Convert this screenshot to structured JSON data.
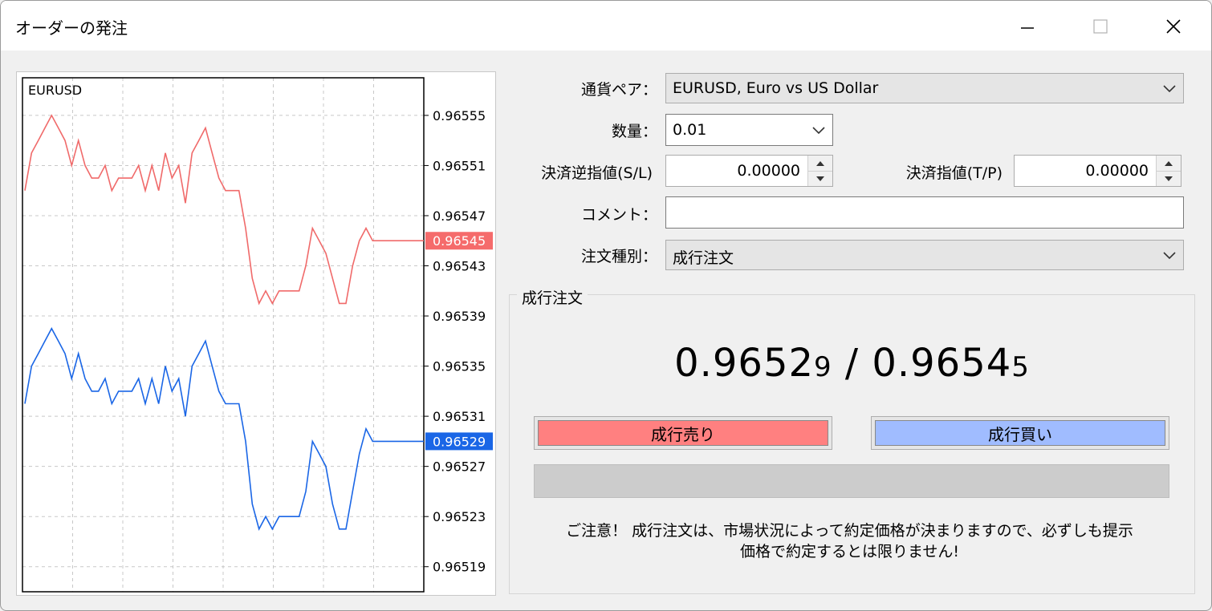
{
  "window": {
    "title": "オーダーの発注",
    "minimize_icon": "minimize-icon",
    "maximize_icon": "maximize-icon",
    "close_icon": "close-icon"
  },
  "chart": {
    "symbol": "EURUSD",
    "price_labels": [
      "0.96555",
      "0.96551",
      "0.96547",
      "0.96543",
      "0.96539",
      "0.96535",
      "0.96531",
      "0.96527",
      "0.96523",
      "0.96519"
    ],
    "ask_badge": "0.96545",
    "bid_badge": "0.96529",
    "colors": {
      "ask": "#f06a6a",
      "bid": "#1a66e6",
      "ask_badge_bg": "#f56b6b",
      "bid_badge_bg": "#1a66e6"
    }
  },
  "chart_data": {
    "type": "line",
    "title": "EURUSD",
    "ylim": [
      0.96517,
      0.96558
    ],
    "grid": true,
    "series": [
      {
        "values": [
          0.96549,
          0.96552,
          0.96553,
          0.96554,
          0.96555,
          0.96554,
          0.96553,
          0.96551,
          0.96553,
          0.96551,
          0.9655,
          0.9655,
          0.96551,
          0.96549,
          0.9655,
          0.9655,
          0.9655,
          0.96551,
          0.96549,
          0.96551,
          0.96549,
          0.96552,
          0.9655,
          0.96551,
          0.96548,
          0.96552,
          0.96553,
          0.96554,
          0.96552,
          0.9655,
          0.96549,
          0.96549,
          0.96549,
          0.96546,
          0.96542,
          0.9654,
          0.96541,
          0.9654,
          0.96541,
          0.96541,
          0.96541,
          0.96541,
          0.96543,
          0.96546,
          0.96545,
          0.96544,
          0.96542,
          0.9654,
          0.9654,
          0.96543,
          0.96545,
          0.96546,
          0.96545,
          0.96545,
          0.96545
        ]
      },
      {
        "values": [
          0.96532,
          0.96535,
          0.96536,
          0.96537,
          0.96538,
          0.96537,
          0.96536,
          0.96534,
          0.96536,
          0.96534,
          0.96533,
          0.96533,
          0.96534,
          0.96532,
          0.96533,
          0.96533,
          0.96533,
          0.96534,
          0.96532,
          0.96534,
          0.96532,
          0.96535,
          0.96533,
          0.96534,
          0.96531,
          0.96535,
          0.96536,
          0.96537,
          0.96535,
          0.96533,
          0.96532,
          0.96532,
          0.96532,
          0.96529,
          0.96524,
          0.96522,
          0.96523,
          0.96522,
          0.96523,
          0.96523,
          0.96523,
          0.96523,
          0.96525,
          0.96529,
          0.96528,
          0.96527,
          0.96524,
          0.96522,
          0.96522,
          0.96525,
          0.96528,
          0.9653,
          0.96529,
          0.96529,
          0.96529
        ]
      }
    ]
  },
  "form": {
    "pair_label": "通貨ペア：",
    "pair_value": "EURUSD, Euro vs US Dollar",
    "volume_label": "数量：",
    "volume_value": "0.01",
    "sl_label": "決済逆指値(S/L)",
    "sl_value": "0.00000",
    "tp_label": "決済指値(T/P)",
    "tp_value": "0.00000",
    "comment_label": "コメント：",
    "comment_value": "",
    "type_label": "注文種別：",
    "type_value": "成行注文"
  },
  "market": {
    "group_title": "成行注文",
    "bid_main": "0.9652",
    "bid_small": "9",
    "separator": " / ",
    "ask_main": "0.9654",
    "ask_small": "5",
    "sell_label": "成行売り",
    "buy_label": "成行買い",
    "sell_color": "#ff8080",
    "buy_color": "#a0bcff",
    "notice_line1": "ご注意！ 成行注文は、市場状況によって約定価格が決まりますので、必ずしも提示",
    "notice_line2": "価格で約定するとは限りません!"
  }
}
